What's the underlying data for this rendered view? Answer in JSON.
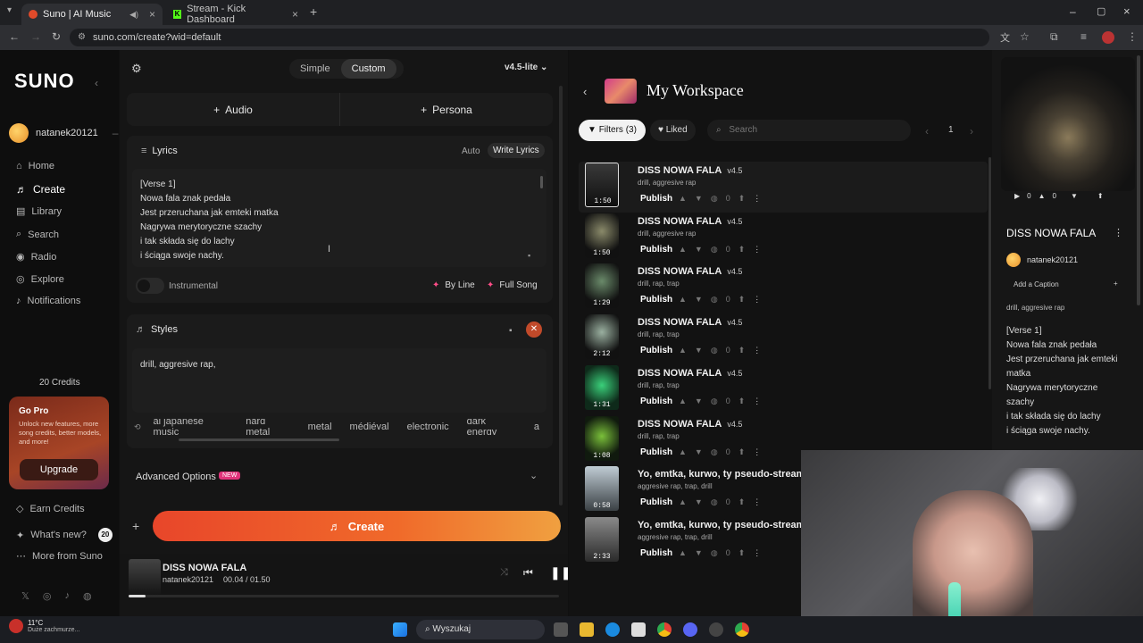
{
  "browser": {
    "tabs": [
      {
        "title": "Suno | AI Music"
      },
      {
        "title": "Stream - Kick Dashboard"
      }
    ],
    "url": "suno.com/create?wid=default"
  },
  "sidebar": {
    "logo": "SUNO",
    "username": "natanek20121",
    "nav": [
      {
        "label": "Home",
        "icon": "home-icon"
      },
      {
        "label": "Create",
        "icon": "create-icon"
      },
      {
        "label": "Library",
        "icon": "library-icon"
      },
      {
        "label": "Search",
        "icon": "search-icon"
      },
      {
        "label": "Radio",
        "icon": "radio-icon"
      },
      {
        "label": "Explore",
        "icon": "explore-icon"
      },
      {
        "label": "Notifications",
        "icon": "bell-icon"
      }
    ],
    "credits": "20 Credits",
    "gopro": {
      "title": "Go Pro",
      "text": "Unlock new features, more song credits, better models, and more!",
      "button": "Upgrade"
    },
    "bottom": [
      {
        "label": "Earn Credits"
      },
      {
        "label": "What's new?",
        "badge": "20"
      },
      {
        "label": "More from Suno"
      }
    ]
  },
  "create": {
    "modes": [
      "Simple",
      "Custom"
    ],
    "active_mode": "Custom",
    "model": "v4.5-lite",
    "audio_button": "Audio",
    "persona_button": "Persona",
    "lyrics": {
      "label": "Lyrics",
      "auto": "Auto",
      "write": "Write Lyrics",
      "lines": [
        "[Verse 1]",
        "Nowa fala znak pedała",
        "Jest przeruchana jak emteki matka",
        "Nagrywa merytoryczne szachy",
        "i tak składa się do lachy",
        "i ściąga swoje nachy."
      ]
    },
    "instrumental": "Instrumental",
    "by_line": "By Line",
    "full_song": "Full Song",
    "styles": {
      "label": "Styles",
      "value": "drill, aggresive rap,",
      "chips": [
        "al japanese music",
        "hard metal",
        "metal",
        "médiéval",
        "electronic",
        "dark energy",
        "a"
      ]
    },
    "advanced": "Advanced Options",
    "advanced_badge": "NEW",
    "create_button": "Create"
  },
  "player": {
    "title": "DISS NOWA FALA",
    "artist": "natanek20121",
    "time": "00.04 / 01.50",
    "progress": 0.04
  },
  "workspace": {
    "title": "My Workspace",
    "filters": "Filters (3)",
    "liked": "Liked",
    "search_placeholder": "Search",
    "page": "1",
    "rows": [
      {
        "title": "DISS NOWA FALA",
        "version": "v4.5",
        "tags": "drill, aggresive rap",
        "duration": "1:50",
        "publish": "Publish",
        "count": "0"
      },
      {
        "title": "DISS NOWA FALA",
        "version": "v4.5",
        "tags": "drill, aggresive rap",
        "duration": "1:50",
        "publish": "Publish",
        "count": "0"
      },
      {
        "title": "DISS NOWA FALA",
        "version": "v4.5",
        "tags": "drill, rap, trap",
        "duration": "1:29",
        "publish": "Publish",
        "count": "0"
      },
      {
        "title": "DISS NOWA FALA",
        "version": "v4.5",
        "tags": "drill, rap, trap",
        "duration": "2:12",
        "publish": "Publish",
        "count": "0"
      },
      {
        "title": "DISS NOWA FALA",
        "version": "v4.5",
        "tags": "drill, rap, trap",
        "duration": "1:31",
        "publish": "Publish",
        "count": "0"
      },
      {
        "title": "DISS NOWA FALA",
        "version": "v4.5",
        "tags": "drill, rap, trap",
        "duration": "1:08",
        "publish": "Publish",
        "count": "0"
      },
      {
        "title": "Yo, emtka, kurwo, ty pseudo-streamezε",
        "version": "",
        "tags": "aggresive rap, trap, drill",
        "duration": "0:58",
        "publish": "Publish",
        "count": "0"
      },
      {
        "title": "Yo, emtka, kurwo, ty pseudo-streamezε",
        "version": "",
        "tags": "aggresive rap, trap, drill",
        "duration": "2:33",
        "publish": "Publish",
        "count": "0"
      }
    ]
  },
  "detail": {
    "play_count": "0",
    "like_count": "0",
    "title": "DISS NOWA FALA",
    "artist": "natanek20121",
    "caption": "Add a Caption",
    "tags": "drill, aggresive rap",
    "lyrics": [
      "[Verse 1]",
      "Nowa fala znak pedała",
      "Jest przeruchana jak emteki",
      "matka",
      "Nagrywa merytoryczne",
      "szachy",
      "i tak składa się do lachy",
      "i ściąga swoje nachy."
    ]
  },
  "taskbar": {
    "weather_temp": "11°C",
    "weather_desc": "Duże zachmurze...",
    "search": "Wyszukaj"
  },
  "colors": {
    "accent": "#ff5a1f",
    "create_gradient_start": "#e8462a",
    "create_gradient_end": "#f0a040",
    "badge": "#e0337a"
  }
}
